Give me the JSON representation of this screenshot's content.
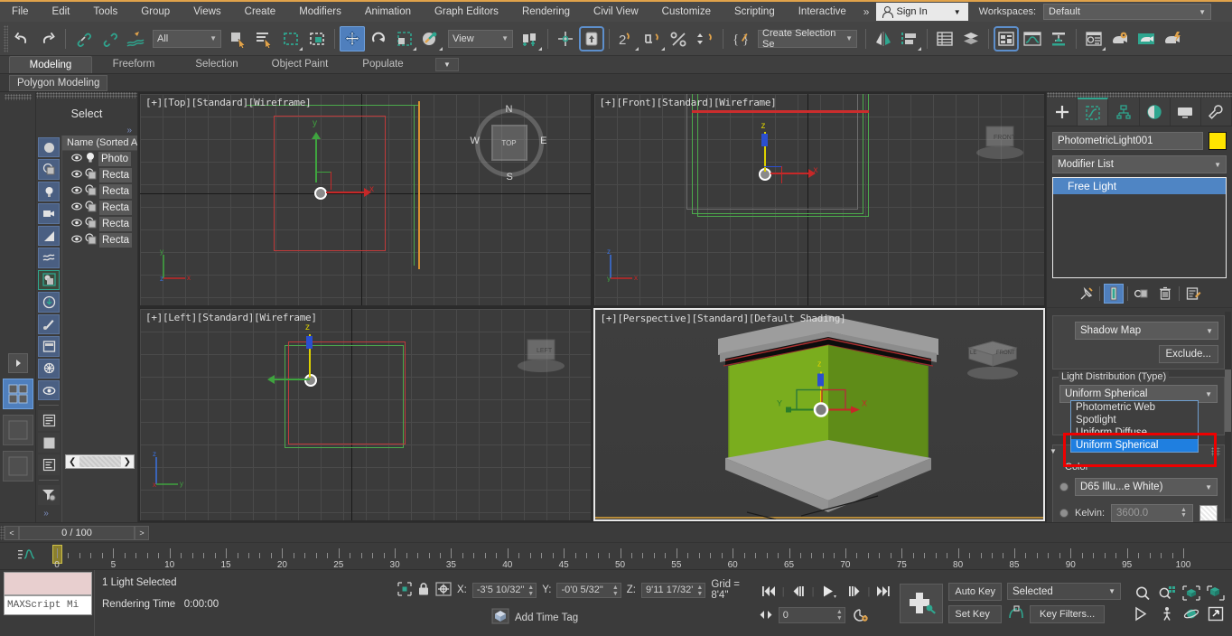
{
  "app": {
    "title": "Autodesk 3ds Max"
  },
  "menu": {
    "items": [
      "File",
      "Edit",
      "Tools",
      "Group",
      "Views",
      "Create",
      "Modifiers",
      "Animation",
      "Graph Editors",
      "Rendering",
      "Civil View",
      "Customize",
      "Scripting",
      "Interactive"
    ],
    "overflow": "»",
    "sign_in": "Sign In",
    "workspaces_label": "Workspaces:",
    "workspace_value": "Default"
  },
  "toolbar": {
    "selection_filter": "All",
    "reference_coord": "View",
    "named_selection_set": "Create Selection Se",
    "icons": [
      "undo-icon",
      "redo-icon",
      "select-link-icon",
      "unlink-icon",
      "bind-space-warp-icon",
      "select-object-icon",
      "select-by-name-icon",
      "rectangular-region-icon",
      "window-crossing-icon",
      "select-and-move-icon",
      "select-and-rotate-icon",
      "select-and-scale-icon",
      "placement-icon",
      "use-pivot-icon",
      "use-center-icon",
      "snap-toggle-icon",
      "angle-snap-icon",
      "percent-snap-icon",
      "spinner-snap-icon",
      "edit-named-selection-icon",
      "mirror-icon",
      "align-icon",
      "layer-explorer-icon",
      "layer-manager-icon",
      "ribbon-toggle-icon",
      "curve-editor-icon",
      "schematic-view-icon",
      "material-editor-icon",
      "render-setup-icon",
      "render-frame-icon",
      "render-production-icon"
    ]
  },
  "ribbon": {
    "tabs": [
      "Modeling",
      "Freeform",
      "Selection",
      "Object Paint",
      "Populate"
    ],
    "active_tab": "Modeling",
    "panel_tab": "Polygon Modeling"
  },
  "left_rail": {
    "icons": [
      "dots-grip-icon",
      "quad-view-icon",
      "view-layout-1-icon",
      "view-layout-2-icon",
      "expand-arrow-icon"
    ]
  },
  "explorer": {
    "title": "Select",
    "more": "»",
    "column_header": "Name (Sorted A",
    "rows": [
      {
        "name": "Photo",
        "icon": "light-bulb-icon",
        "visible": true
      },
      {
        "name": "Recta",
        "icon": "object-icon",
        "visible": true
      },
      {
        "name": "Recta",
        "icon": "object-icon",
        "visible": true
      },
      {
        "name": "Recta",
        "icon": "object-icon",
        "visible": true
      },
      {
        "name": "Recta",
        "icon": "object-icon",
        "visible": true
      },
      {
        "name": "Recta",
        "icon": "object-icon",
        "visible": true
      }
    ],
    "filter_icons": [
      "select-all-icon",
      "select-shapes-icon",
      "select-lights-icon",
      "select-cameras-icon",
      "select-helpers-icon",
      "select-spacewarps-icon",
      "select-groups-icon",
      "select-xrefs-icon",
      "select-bones-icon",
      "select-containers-icon",
      "select-particles-icon",
      "select-display-icon",
      "sort-icon",
      "blank-icon",
      "column-icon",
      "filter-icon"
    ],
    "footer_more": "»"
  },
  "viewports": [
    {
      "id": "top",
      "label": "[+][Top][Standard][Wireframe]",
      "active": false
    },
    {
      "id": "front",
      "label": "[+][Front][Standard][Wireframe]",
      "active": false
    },
    {
      "id": "left",
      "label": "[+][Left][Standard][Wireframe]",
      "active": false
    },
    {
      "id": "perspective",
      "label": "[+][Perspective][Standard][Default Shading]",
      "active": true
    }
  ],
  "viewcube": {
    "n": "N",
    "s": "S",
    "e": "E",
    "w": "W",
    "face": "TOP"
  },
  "vp_cube_labels": {
    "front": "FRONT",
    "left": "LEFT",
    "persp": "LE..NT"
  },
  "command_panel": {
    "tabs": [
      "create-tab",
      "modify-tab",
      "hierarchy-tab",
      "motion-tab",
      "display-tab",
      "utilities-tab"
    ],
    "active_tab_index": 1,
    "object_name": "PhotometricLight001",
    "object_color": "#ffe400",
    "modifier_list_label": "Modifier List",
    "stack_items": [
      "Free Light"
    ],
    "stack_selected": "Free Light",
    "stack_buttons": [
      "pin-stack-icon",
      "show-end-result-icon",
      "make-unique-icon",
      "remove-modifier-icon",
      "configure-sets-icon"
    ],
    "shadow_type": "Shadow Map",
    "exclude_button": "Exclude...",
    "light_distribution_group": "Light Distribution (Type)",
    "light_distribution_value": "Uniform Spherical",
    "light_distribution_options": [
      "Photometric Web",
      "Spotlight",
      "Uniform Diffuse",
      "Uniform Spherical"
    ],
    "light_distribution_selected": "Uniform Spherical",
    "color_group": "Color",
    "preset_color": "D65 Illu...e White)",
    "kelvin_label": "Kelvin:",
    "kelvin_value": "3600.0"
  },
  "timeline": {
    "prev_label": "<",
    "next_label": ">",
    "frame_readout": "0 / 100",
    "ticks": [
      0,
      5,
      10,
      15,
      20,
      25,
      30,
      35,
      40,
      45,
      50,
      55,
      60,
      65,
      70,
      75,
      80,
      85,
      90,
      95,
      100
    ],
    "slider_frame": 0
  },
  "status": {
    "maxscript_label": "MAXScript Mi",
    "selection_text": "1 Light Selected",
    "rendering_time_label": "Rendering Time",
    "rendering_time_value": "0:00:00",
    "x_label": "X:",
    "x_value": "-3'5 10/32\"",
    "y_label": "Y:",
    "y_value": "-0'0 5/32\"",
    "z_label": "Z:",
    "z_value": "9'11 17/32'",
    "grid_label": "Grid = 8'4\"",
    "add_time_tag": "Add Time Tag",
    "lock_icon": "lock-selection-icon",
    "coord_mode_icon": "absolute-relative-icon"
  },
  "animation": {
    "auto_key": "Auto Key",
    "set_key": "Set Key",
    "key_mode": "Selected",
    "key_filters": "Key Filters...",
    "current_frame": "0",
    "playback_icons": [
      "go-to-start-icon",
      "prev-frame-icon",
      "play-icon",
      "next-frame-icon",
      "go-to-end-icon"
    ],
    "nav_icons": [
      "zoom-icon",
      "zoom-all-icon",
      "zoom-extents-icon",
      "zoom-region-icon",
      "pan-icon",
      "walkthrough-icon",
      "orbit-icon",
      "maximize-viewport-icon"
    ]
  }
}
